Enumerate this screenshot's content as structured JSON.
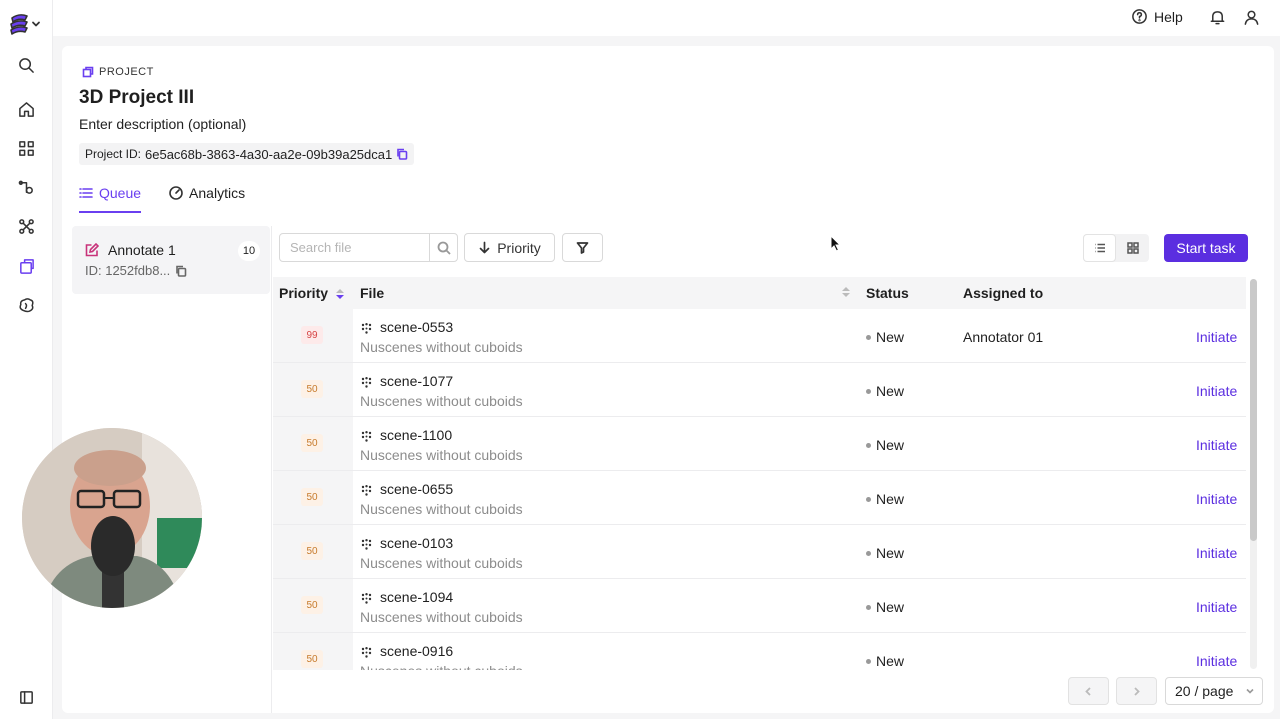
{
  "topbar": {
    "help_label": "Help"
  },
  "project": {
    "crumb": "PROJECT",
    "title": "3D Project III",
    "description": "Enter description (optional)",
    "id_label": "Project ID:",
    "id_value": "6e5ac68b-3863-4a30-aa2e-09b39a25dca1"
  },
  "tabs": [
    {
      "label": "Queue",
      "active": true
    },
    {
      "label": "Analytics",
      "active": false
    }
  ],
  "stage": {
    "name": "Annotate 1",
    "count": "10",
    "id": "ID: 1252fdb8..."
  },
  "toolbar": {
    "search_placeholder": "Search file",
    "priority_label": "Priority",
    "start_label": "Start task"
  },
  "table": {
    "headers": {
      "priority": "Priority",
      "file": "File",
      "status": "Status",
      "assigned": "Assigned to"
    },
    "rows": [
      {
        "priority": "99",
        "file": "scene-0553",
        "dataset": "Nuscenes without cuboids",
        "status": "New",
        "assigned": "Annotator 01",
        "action": "Initiate"
      },
      {
        "priority": "50",
        "file": "scene-1077",
        "dataset": "Nuscenes without cuboids",
        "status": "New",
        "assigned": "",
        "action": "Initiate"
      },
      {
        "priority": "50",
        "file": "scene-1100",
        "dataset": "Nuscenes without cuboids",
        "status": "New",
        "assigned": "",
        "action": "Initiate"
      },
      {
        "priority": "50",
        "file": "scene-0655",
        "dataset": "Nuscenes without cuboids",
        "status": "New",
        "assigned": "",
        "action": "Initiate"
      },
      {
        "priority": "50",
        "file": "scene-0103",
        "dataset": "Nuscenes without cuboids",
        "status": "New",
        "assigned": "",
        "action": "Initiate"
      },
      {
        "priority": "50",
        "file": "scene-1094",
        "dataset": "Nuscenes without cuboids",
        "status": "New",
        "assigned": "",
        "action": "Initiate"
      },
      {
        "priority": "50",
        "file": "scene-0916",
        "dataset": "Nuscenes without cuboids",
        "status": "New",
        "assigned": "",
        "action": "Initiate"
      }
    ]
  },
  "pagination": {
    "page_size": "20 / page"
  },
  "colors": {
    "accent": "#5b2ee0",
    "priority_high": "#d64545",
    "priority_mid": "#c77b2c"
  },
  "icons": [
    "logo-icon",
    "search-icon",
    "home-icon",
    "grid-icon",
    "workflow-icon",
    "network-icon",
    "project-icon",
    "brain-icon",
    "sidebar-toggle-icon",
    "help-icon",
    "bell-icon",
    "user-icon",
    "copy-icon",
    "list-icon",
    "dashboard-icon",
    "edit-icon",
    "arrow-down-icon",
    "filter-icon",
    "cuboid-icon"
  ]
}
